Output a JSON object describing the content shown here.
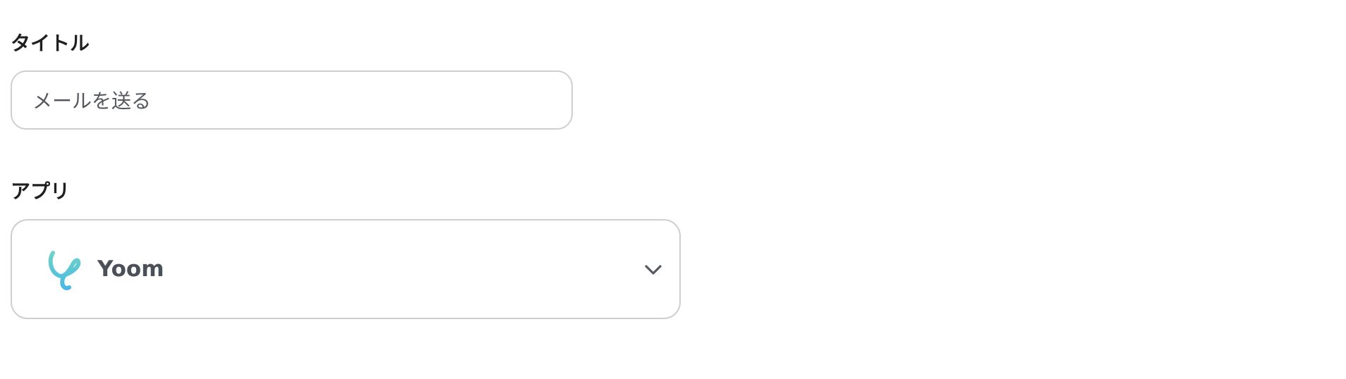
{
  "form": {
    "title_field": {
      "label": "タイトル",
      "value": "メールを送る"
    },
    "app_field": {
      "label": "アプリ",
      "selected_app": "Yoom",
      "selected_icon": "yoom-logo-icon",
      "dropdown_icon": "chevron-down-icon"
    }
  },
  "colors": {
    "logo_gradient_top": "#6fd3c6",
    "logo_gradient_bottom": "#4ab8e6",
    "border": "#cfcfcf",
    "label_text": "#1f1f1f",
    "value_text": "#55585e"
  }
}
